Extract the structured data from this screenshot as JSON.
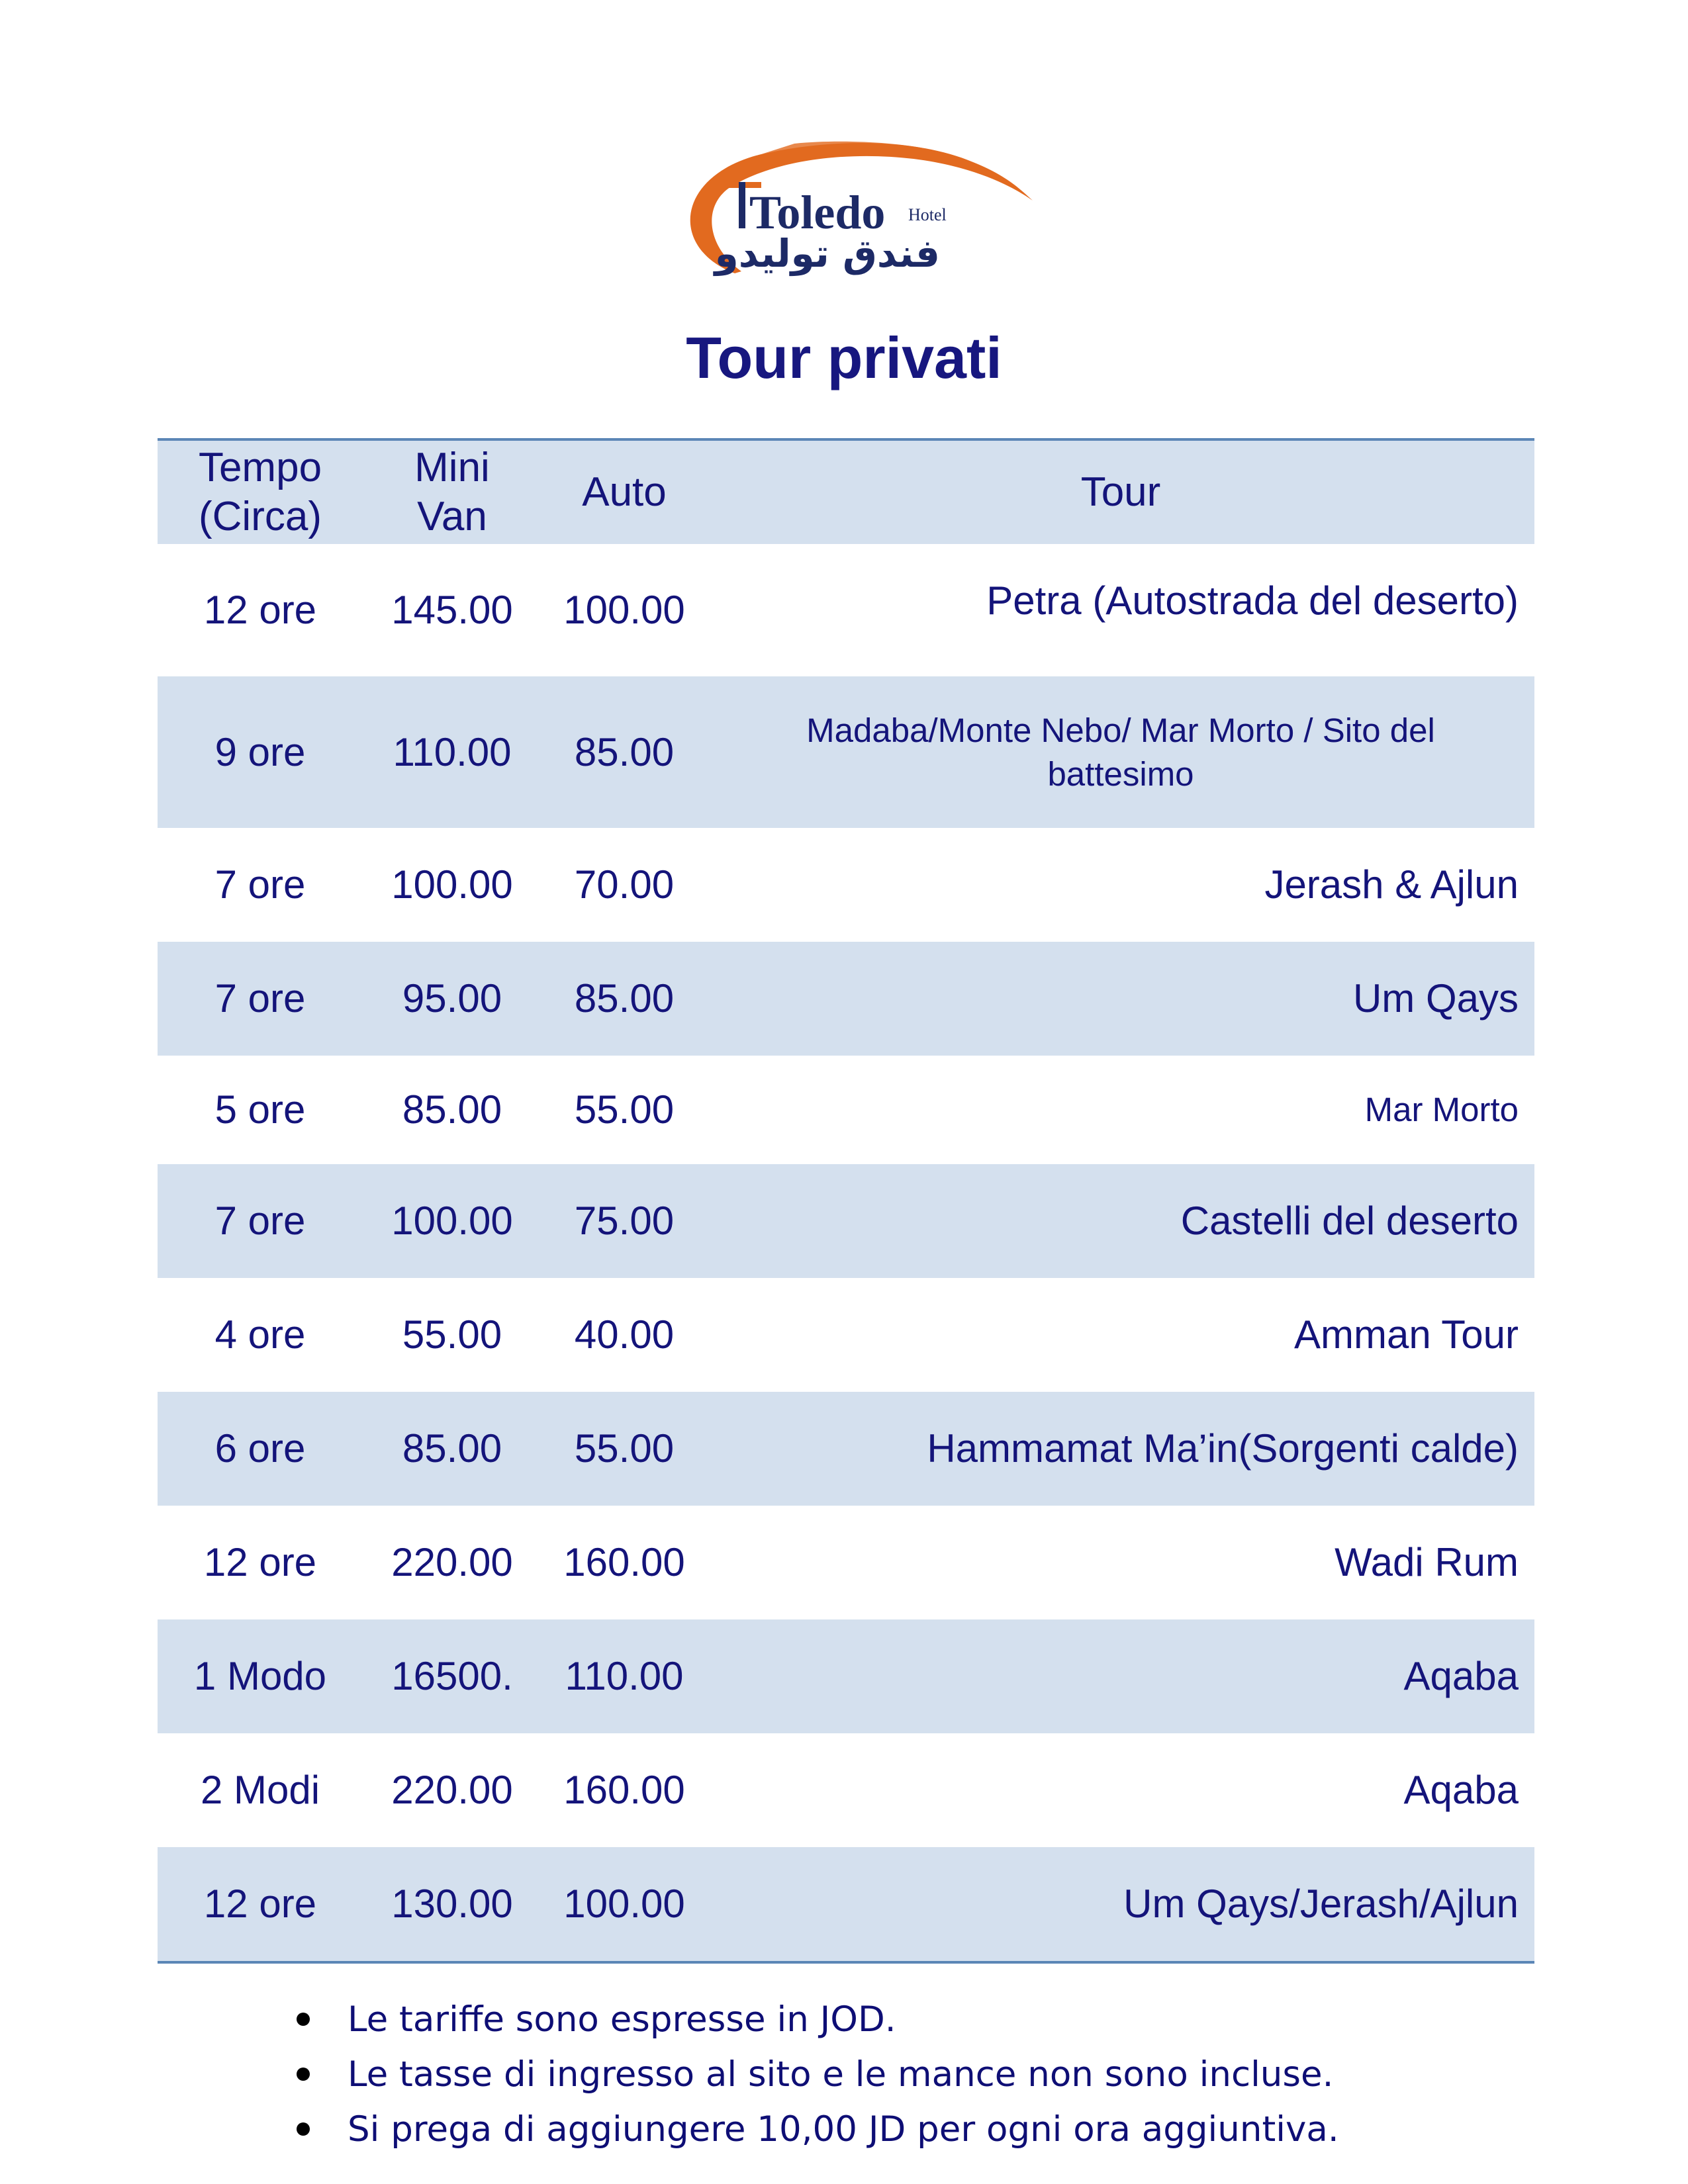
{
  "logo": {
    "name": "Toledo",
    "sub": "Hotel",
    "arabic": "فندق توليدو",
    "accent": "#e26a1f",
    "text_color": "#1d2a66"
  },
  "title": "Tour privati",
  "table": {
    "headers": {
      "time": "Tempo\n(Circa)",
      "van": "Mini\nVan",
      "auto": "Auto",
      "tour": "Tour"
    },
    "rows": [
      {
        "time": "12 ore",
        "van": "145.00",
        "auto": "100.00",
        "tour": "Petra (Autostrada del deserto)"
      },
      {
        "time": "9 ore",
        "van": "110.00",
        "auto": "85.00",
        "tour": "Madaba/Monte Nebo/ Mar Morto / Sito del battesimo"
      },
      {
        "time": "7 ore",
        "van": "100.00",
        "auto": "70.00",
        "tour": "Jerash & Ajlun"
      },
      {
        "time": "7 ore",
        "van": "95.00",
        "auto": "85.00",
        "tour": "Um Qays"
      },
      {
        "time": "5 ore",
        "van": "85.00",
        "auto": "55.00",
        "tour": "Mar Morto"
      },
      {
        "time": "7 ore",
        "van": "100.00",
        "auto": "75.00",
        "tour": "Castelli del deserto"
      },
      {
        "time": "4 ore",
        "van": "55.00",
        "auto": "40.00",
        "tour": "Amman Tour"
      },
      {
        "time": "6 ore",
        "van": "85.00",
        "auto": "55.00",
        "tour": "Hammamat Ma’in(Sorgenti calde)"
      },
      {
        "time": "12 ore",
        "van": "220.00",
        "auto": "160.00",
        "tour": "Wadi Rum"
      },
      {
        "time": "1 Modo",
        "van": "16500.",
        "auto": "110.00",
        "tour": "Aqaba"
      },
      {
        "time": "2 Modi",
        "van": "220.00",
        "auto": "160.00",
        "tour": "Aqaba"
      },
      {
        "time": "12 ore",
        "van": "130.00",
        "auto": "100.00",
        "tour": "Um Qays/Jerash/Ajlun"
      }
    ]
  },
  "notes": [
    "Le tariffe sono espresse in JOD.",
    "Le tasse di ingresso al sito e le mance non sono incluse.",
    "Si prega di aggiungere 10,00 JD per ogni ora aggiuntiva."
  ]
}
